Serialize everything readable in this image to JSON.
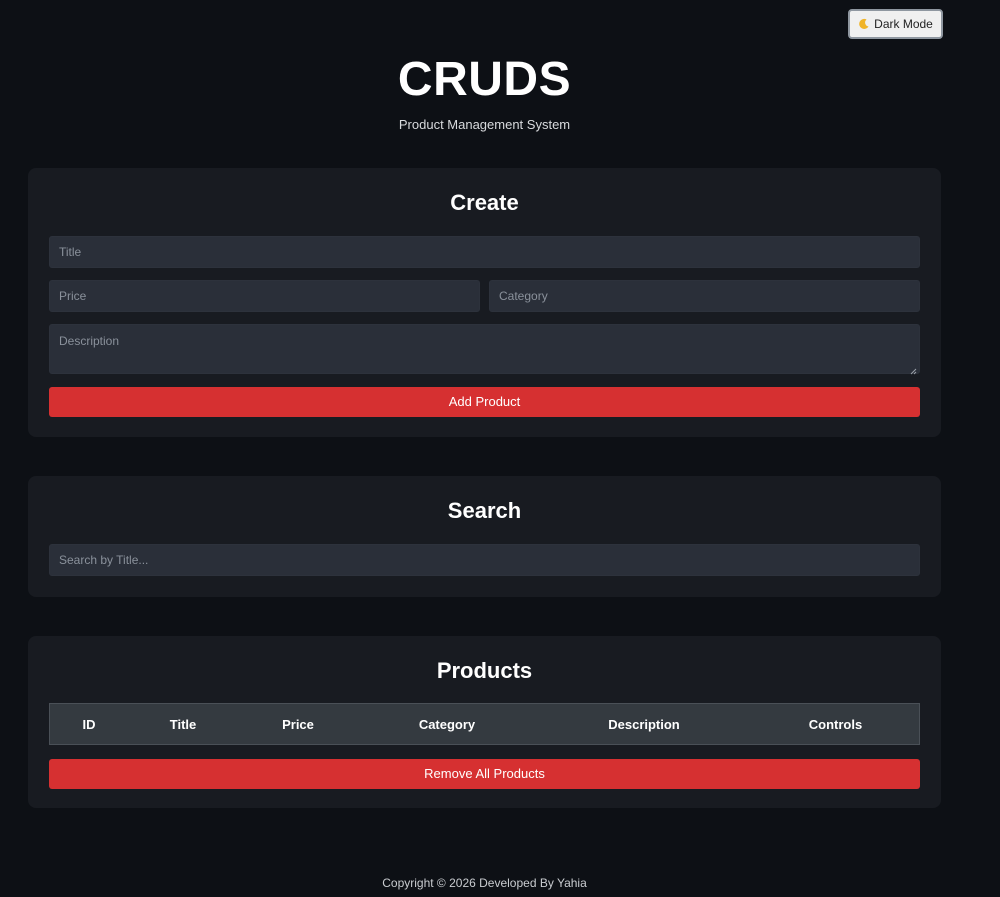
{
  "theme_toggle": {
    "label": "Dark Mode",
    "icon": "moon-icon"
  },
  "header": {
    "title": "CRUDS",
    "subtitle": "Product Management System"
  },
  "create": {
    "heading": "Create",
    "title_placeholder": "Title",
    "price_placeholder": "Price",
    "category_placeholder": "Category",
    "description_placeholder": "Description",
    "submit_label": "Add Product"
  },
  "search": {
    "heading": "Search",
    "placeholder": "Search by Title..."
  },
  "products": {
    "heading": "Products",
    "columns": [
      "ID",
      "Title",
      "Price",
      "Category",
      "Description",
      "Controls"
    ],
    "remove_all_label": "Remove All Products"
  },
  "footer": {
    "text": "Copyright © 2026 Developed By Yahia"
  },
  "colors": {
    "background": "#0d1015",
    "card": "#181b21",
    "input": "#2a2f39",
    "accent_red": "#d63031",
    "table_header": "#343a40"
  }
}
